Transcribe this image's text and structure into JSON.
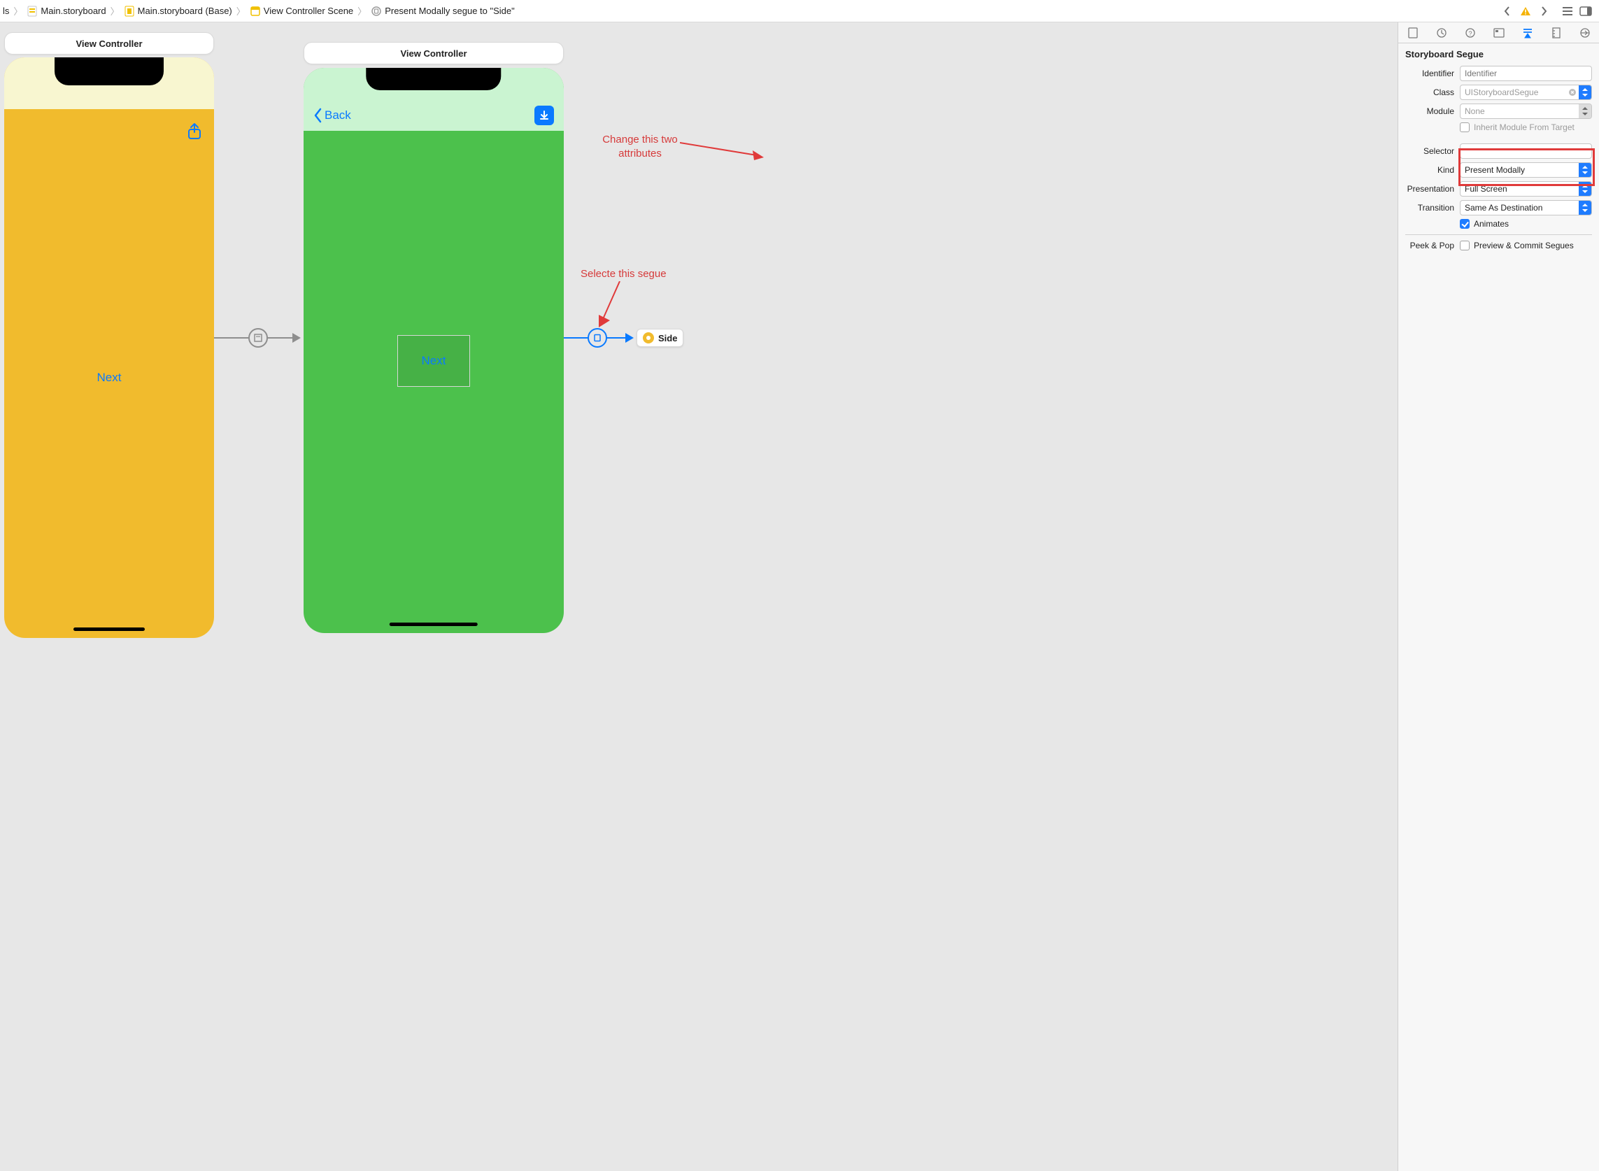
{
  "breadcrumb": {
    "seg0": "ls",
    "seg1": "Main.storyboard",
    "seg2": "Main.storyboard (Base)",
    "seg3": "View Controller Scene",
    "seg4": "Present Modally segue to \"Side\""
  },
  "canvas": {
    "vc1_title": "View Controller",
    "vc2_title": "View Controller",
    "vc1_button": "Next",
    "vc2_back": "Back",
    "vc2_container_label": "Next",
    "side_chip": "Side"
  },
  "annotations": {
    "attr_note_l1": "Change this two",
    "attr_note_l2": "attributes",
    "segue_note": "Selecte this segue"
  },
  "inspector": {
    "section_title": "Storyboard Segue",
    "labels": {
      "identifier": "Identifier",
      "class": "Class",
      "module": "Module",
      "inherit": "Inherit Module From Target",
      "selector": "Selector",
      "kind": "Kind",
      "presentation": "Presentation",
      "transition": "Transition",
      "animates": "Animates",
      "peekpop": "Peek & Pop",
      "peekpop_val": "Preview & Commit Segues"
    },
    "values": {
      "identifier_placeholder": "Identifier",
      "class_placeholder": "UIStoryboardSegue",
      "module_placeholder": "None",
      "kind": "Present Modally",
      "presentation": "Full Screen",
      "transition": "Same As Destination",
      "animates_checked": true,
      "inherit_checked": false,
      "peekpop_checked": false
    }
  }
}
